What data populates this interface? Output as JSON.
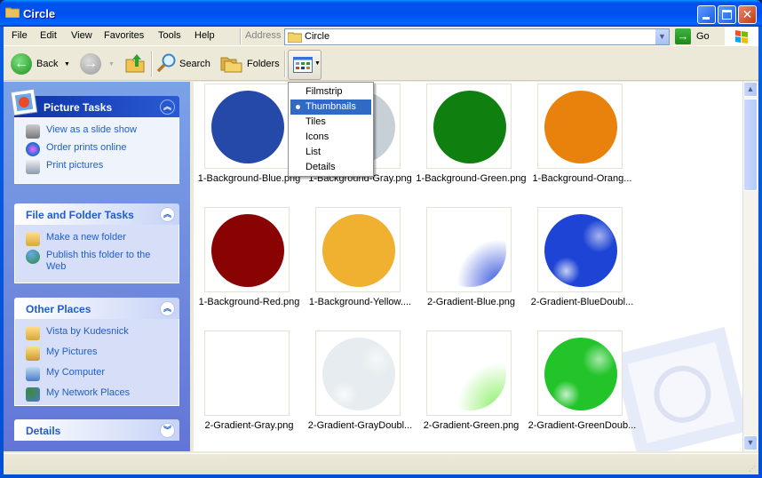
{
  "window": {
    "title": "Circle"
  },
  "menubar": {
    "items": [
      "File",
      "Edit",
      "View",
      "Favorites",
      "Tools",
      "Help"
    ]
  },
  "address": {
    "label": "Address",
    "value": "Circle",
    "go_label": "Go"
  },
  "toolbar": {
    "back_label": "Back",
    "search_label": "Search",
    "folders_label": "Folders"
  },
  "views_menu": {
    "items": [
      "Filmstrip",
      "Thumbnails",
      "Tiles",
      "Icons",
      "List",
      "Details"
    ],
    "selected": "Thumbnails"
  },
  "sidebar": {
    "picture_tasks": {
      "title": "Picture Tasks",
      "links": [
        "View as a slide show",
        "Order prints online",
        "Print pictures"
      ]
    },
    "file_folder_tasks": {
      "title": "File and Folder Tasks",
      "links": [
        "Make a new folder",
        "Publish this folder to the Web"
      ]
    },
    "other_places": {
      "title": "Other Places",
      "links": [
        "Vista by Kudesnick",
        "My Pictures",
        "My Computer",
        "My Network Places"
      ]
    },
    "details": {
      "title": "Details"
    }
  },
  "files": [
    {
      "name": "1-Background-Blue.png",
      "color": "#2549a8"
    },
    {
      "name": "1-Background-Gray.png",
      "color": "#c6d0d6"
    },
    {
      "name": "1-Background-Green.png",
      "color": "#0f800f"
    },
    {
      "name": "1-Background-Orang...",
      "color": "#e8820c"
    },
    {
      "name": "1-Background-Red.png",
      "color": "#8a0303"
    },
    {
      "name": "1-Background-Yellow....",
      "color": "#f0b030"
    },
    {
      "name": "2-Gradient-Blue.png",
      "color": "#3a58dd"
    },
    {
      "name": "2-Gradient-BlueDoubl...",
      "color": "#1e44d6"
    },
    {
      "name": "2-Gradient-Gray.png",
      "color": "#ffffff"
    },
    {
      "name": "2-Gradient-GrayDoubl...",
      "color": "#e6ecef"
    },
    {
      "name": "2-Gradient-Green.png",
      "color": "#8ef06a"
    },
    {
      "name": "2-Gradient-GreenDoub...",
      "color": "#22c42a"
    }
  ]
}
